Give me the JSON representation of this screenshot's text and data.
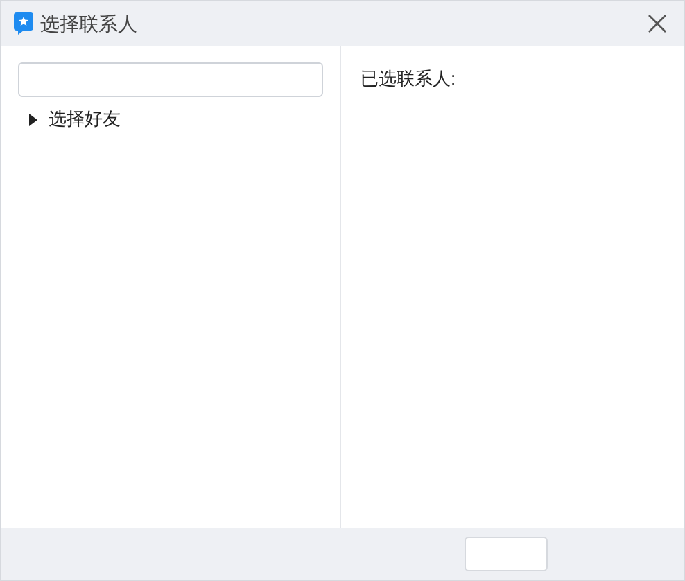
{
  "window": {
    "title": "选择联系人"
  },
  "tree": [
    {
      "label": "选择好友",
      "expanded": false
    }
  ],
  "selected_panel": {
    "heading": "已选联系人:"
  }
}
